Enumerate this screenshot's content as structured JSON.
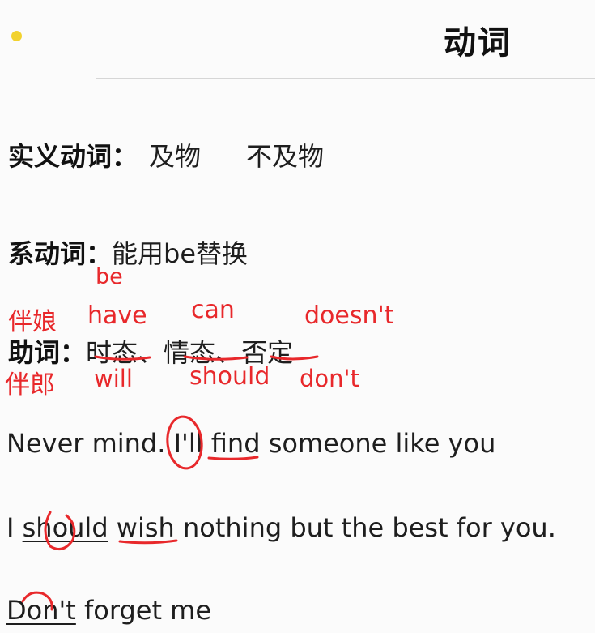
{
  "header": {
    "title": "动词"
  },
  "section_shiyi": {
    "label": "实义动词：",
    "item1": "及物",
    "item2": "不及物"
  },
  "section_xi": {
    "label": "系动词：",
    "desc": "能用be替换"
  },
  "section_zhu": {
    "label": "助词：",
    "term1": "时态",
    "sep1": "、",
    "term2": "情态",
    "sep2": "、",
    "term3": "否定"
  },
  "annotations": {
    "bridesmaid": "伴娘",
    "groomsman": "伴郎",
    "be": "be",
    "have": "have",
    "will": "will",
    "can": "can",
    "should": "should",
    "doesnt": "doesn't",
    "dont": "don't"
  },
  "sentences": {
    "s1_a": "Never mind. ",
    "s1_b": "I'll",
    "s1_c": " ",
    "s1_d": "find",
    "s1_e": " someone like you",
    "s2_a": "I ",
    "s2_b": "should",
    "s2_c": " ",
    "s2_d": "wish",
    "s2_e": " nothing but the best for you.",
    "s3_a": "Don't",
    "s3_b": " forget me"
  },
  "colors": {
    "annotation": "#e8282b",
    "dot": "#f2d22e"
  }
}
